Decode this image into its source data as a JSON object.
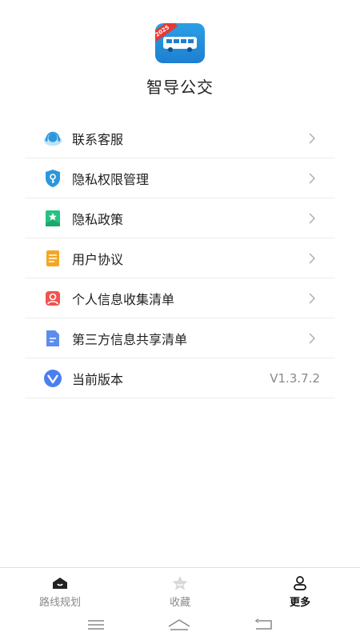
{
  "app": {
    "name": "智导公交",
    "logo_badge": "2025",
    "brand_color": "#1e88e5",
    "badge_color": "#e53935"
  },
  "menu": {
    "items": [
      {
        "label": "联系客服",
        "icon": "customer-service-icon"
      },
      {
        "label": "隐私权限管理",
        "icon": "privacy-permission-icon"
      },
      {
        "label": "隐私政策",
        "icon": "privacy-policy-icon"
      },
      {
        "label": "用户协议",
        "icon": "user-agreement-icon"
      },
      {
        "label": "个人信息收集清单",
        "icon": "personal-info-icon"
      },
      {
        "label": "第三方信息共享清单",
        "icon": "third-party-share-icon"
      }
    ],
    "version": {
      "label": "当前版本",
      "value": "V1.3.7.2",
      "icon": "version-icon"
    }
  },
  "tabbar": {
    "tabs": [
      {
        "label": "路线规划",
        "icon": "route-icon",
        "active": false
      },
      {
        "label": "收藏",
        "icon": "favorite-icon",
        "active": false
      },
      {
        "label": "更多",
        "icon": "profile-icon",
        "active": true
      }
    ]
  },
  "system_nav": {
    "icons": [
      "menu-icon",
      "home-icon",
      "back-icon"
    ]
  }
}
